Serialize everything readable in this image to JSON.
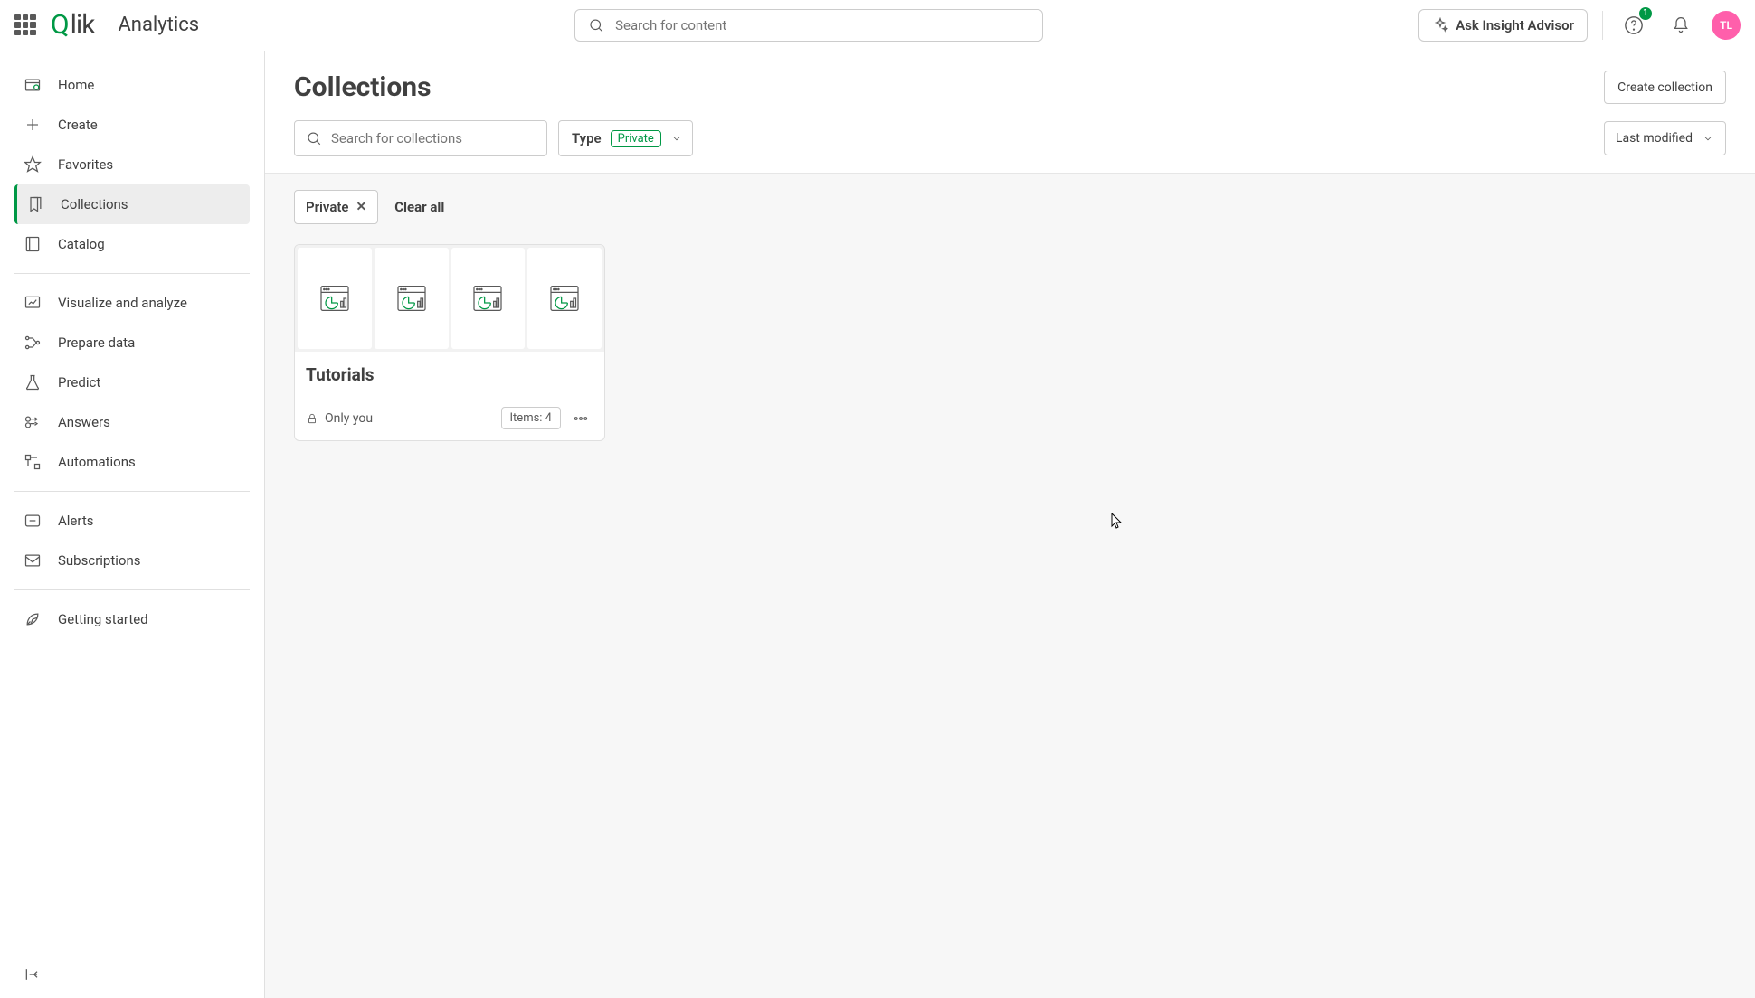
{
  "header": {
    "brand": "Qlik",
    "product": "Analytics",
    "search_placeholder": "Search for content",
    "ask_label": "Ask Insight Advisor",
    "notif_count": "1",
    "avatar_initials": "TL"
  },
  "sidebar": {
    "items": [
      {
        "label": "Home",
        "name": "home"
      },
      {
        "label": "Create",
        "name": "create"
      },
      {
        "label": "Favorites",
        "name": "favorites"
      },
      {
        "label": "Collections",
        "name": "collections"
      },
      {
        "label": "Catalog",
        "name": "catalog"
      },
      {
        "label": "Visualize and analyze",
        "name": "visualize"
      },
      {
        "label": "Prepare data",
        "name": "prepare"
      },
      {
        "label": "Predict",
        "name": "predict"
      },
      {
        "label": "Answers",
        "name": "answers"
      },
      {
        "label": "Automations",
        "name": "automations"
      },
      {
        "label": "Alerts",
        "name": "alerts"
      },
      {
        "label": "Subscriptions",
        "name": "subscriptions"
      },
      {
        "label": "Getting started",
        "name": "getting-started"
      }
    ]
  },
  "page": {
    "title": "Collections",
    "create_button": "Create collection",
    "search_placeholder": "Search for collections",
    "type_label": "Type",
    "type_value": "Private",
    "sort_label": "Last modified",
    "filter_chip": "Private",
    "clear_all": "Clear all"
  },
  "card": {
    "title": "Tutorials",
    "visibility": "Only you",
    "items_label": "Items: 4"
  }
}
